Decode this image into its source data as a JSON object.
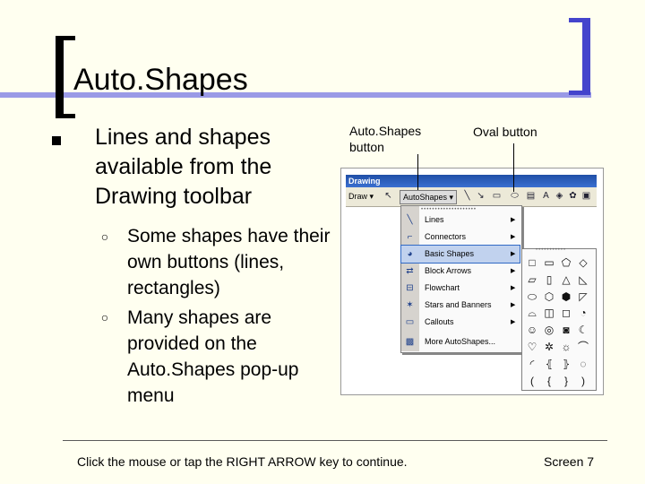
{
  "slide": {
    "title": "Auto.Shapes",
    "bullet": "Lines and shapes available from the Drawing toolbar",
    "sub_bullets": [
      "Some shapes have their own buttons (lines, rectangles)",
      "Many shapes are provided on the Auto.Shapes pop-up menu"
    ],
    "callouts": {
      "autoshapes_button": "Auto.Shapes button",
      "oval_button": "Oval button"
    }
  },
  "toolbar": {
    "title": "Drawing",
    "draw_label": "Draw ▾",
    "autoshapes_label": "AutoShapes ▾",
    "icons": [
      "pointer-icon",
      "line-icon",
      "arrow-icon",
      "rectangle-icon",
      "oval-icon",
      "textbox-icon",
      "wordart-icon",
      "diagram-icon",
      "clipart-icon",
      "picture-icon"
    ]
  },
  "menu": {
    "items": [
      {
        "label": "Lines",
        "icon": "lines-icon",
        "has_submenu": true
      },
      {
        "label": "Connectors",
        "icon": "connectors-icon",
        "has_submenu": true
      },
      {
        "label": "Basic Shapes",
        "icon": "basic-shapes-icon",
        "has_submenu": true,
        "selected": true
      },
      {
        "label": "Block Arrows",
        "icon": "block-arrows-icon",
        "has_submenu": true
      },
      {
        "label": "Flowchart",
        "icon": "flowchart-icon",
        "has_submenu": true
      },
      {
        "label": "Stars and Banners",
        "icon": "stars-banners-icon",
        "has_submenu": true
      },
      {
        "label": "Callouts",
        "icon": "callouts-icon",
        "has_submenu": true
      },
      {
        "label": "More AutoShapes...",
        "icon": "more-autoshapes-icon",
        "has_submenu": false
      }
    ],
    "selection_color": "#c1d2ee"
  },
  "basic_shapes_palette": {
    "glyphs": [
      "□",
      "▭",
      "⬠",
      "◇",
      "▱",
      "▯",
      "△",
      "◺",
      "⬭",
      "⬡",
      "⬢",
      "◸",
      "⌓",
      "◫",
      "◻",
      "◔",
      "☺",
      "◎",
      "◙",
      "☾",
      "♡",
      "✲",
      "☼",
      "⌒",
      "◜",
      "⦃",
      "⦄",
      "◌",
      "(",
      "{",
      "}",
      ")"
    ]
  },
  "footer": {
    "instruction": "Click the mouse or tap the RIGHT ARROW key to continue.",
    "screen": "Screen 7"
  },
  "colors": {
    "background": "#fffff0",
    "title_rule": "#9a9ae6",
    "right_bracket": "#4444cc"
  }
}
